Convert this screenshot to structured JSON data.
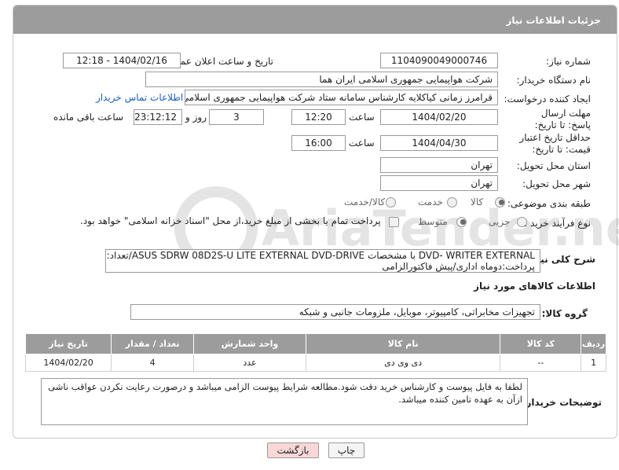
{
  "header": {
    "title": "جزئیات اطلاعات نیاز"
  },
  "watermark": {
    "text": "AriaTender.neT"
  },
  "fields": {
    "need_number_label": "شماره نیاز:",
    "need_number": "1104090049000746",
    "announce_label": "تاریخ و ساعت اعلان عمومی:",
    "announce_value": "1404/02/16 - 12:18",
    "buyer_org_label": "نام دستگاه خریدار:",
    "buyer_org": "شرکت هواپیمایی جمهوری اسلامی ایران هما",
    "creator_label": "ایجاد کننده درخواست:",
    "creator": "قرامرز زمانی کیاکلایه کارشناس سامانه ستاد شرکت هواپیمایی جمهوری اسلامی",
    "contact_link": "اطلاعات تماس خریدار",
    "deadline_label": "مهلت ارسال پاسخ: تا تاریخ:",
    "deadline_date": "1404/02/20",
    "time_label": "ساعت",
    "deadline_time": "12:20",
    "days_value": "3",
    "days_label": "روز و",
    "remaining_time": "23:12:12",
    "remaining_label": "ساعت باقی مانده",
    "validity_label": "حداقل تاریخ اعتبار قیمت: تا تاریخ:",
    "validity_date": "1404/04/30",
    "validity_time": "16:00",
    "province_label": "استان محل تحویل:",
    "province": "تهران",
    "city_label": "شهر محل تحویل:",
    "city": "تهران",
    "category_label": "طبقه بندی موضوعی:",
    "category_options": [
      "کالا",
      "خدمت",
      "کالا/خدمت"
    ],
    "category_selected": 0,
    "process_label": "نوع فرآیند خرید :",
    "process_options": [
      "جزیی",
      "متوسط"
    ],
    "process_selected": 1,
    "payment_note": "پرداخت تمام یا بخشی از مبلغ خرید،از محل \"اسناد خزانه اسلامی\" خواهد بود.",
    "summary_label": "شرح کلی نیاز:",
    "summary_line1": "DVD- WRITER EXTERNAL با مشخصات ASUS SDRW 08D2S-U LITE EXTERNAL DVD-DRIVE/تعداد:4عدد/",
    "summary_line2": "پرداخت:دوماه اداری/پیش فاکتورالزامی",
    "goods_info_title": "اطلاعات کالاهای مورد نیاز",
    "goods_group_label": "گروه کالا:",
    "goods_group": "تجهیزات مخابراتی، کامپیوتر، موبایل، ملزومات جانبی و شبکه",
    "buyer_notes_label": "توضیحات خریدار:",
    "buyer_notes": "لطفا به فایل پیوست و کارشناس خرید دقت شود.مطالعه شرایط پیوست الزامی میباشد و درصورت رعایت نکردن عواقب ناشی ازآن به عهده تامین کننده میباشد."
  },
  "table": {
    "headers": [
      "ردیف",
      "کد کالا",
      "نام کالا",
      "واحد شمارش",
      "تعداد / مقدار",
      "تاریخ نیاز"
    ],
    "rows": [
      [
        "1",
        "--",
        "دی وی دی",
        "عدد",
        "4",
        "1404/02/20"
      ]
    ]
  },
  "buttons": {
    "print": "چاپ",
    "back": "بازگشت"
  },
  "colors": {
    "header_bg": "#9c9c9c",
    "link": "#1a5dc0",
    "back_button_bg": "#f9d7d7"
  }
}
